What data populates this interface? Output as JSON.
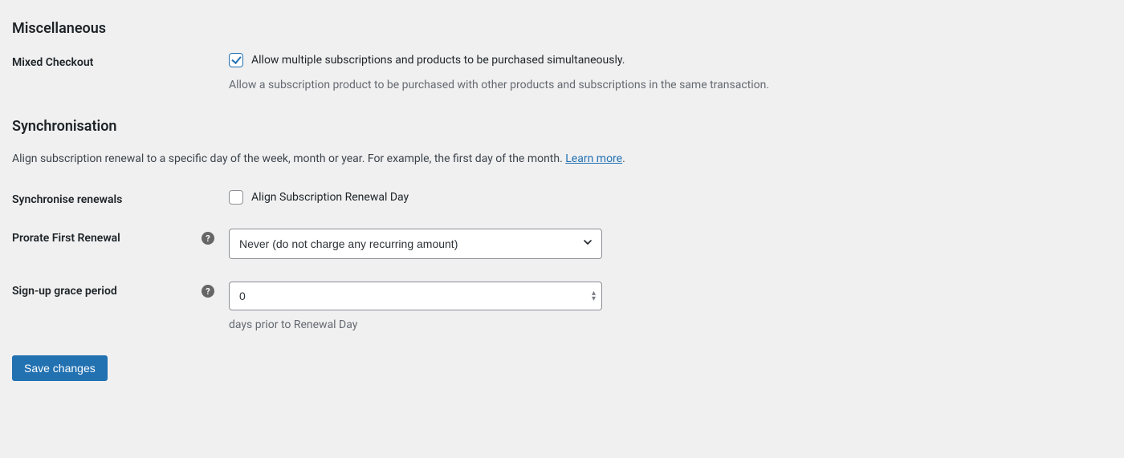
{
  "misc": {
    "heading": "Miscellaneous",
    "mixed_checkout": {
      "label": "Mixed Checkout",
      "checkbox_label": "Allow multiple subscriptions and products to be purchased simultaneously.",
      "description": "Allow a subscription product to be purchased with other products and subscriptions in the same transaction.",
      "checked": true
    }
  },
  "sync": {
    "heading": "Synchronisation",
    "description_prefix": "Align subscription renewal to a specific day of the week, month or year. For example, the first day of the month. ",
    "learn_more": "Learn more",
    "description_suffix": ".",
    "sync_renewals": {
      "label": "Synchronise renewals",
      "checkbox_label": "Align Subscription Renewal Day",
      "checked": false
    },
    "prorate": {
      "label": "Prorate First Renewal",
      "value": "Never (do not charge any recurring amount)"
    },
    "grace": {
      "label": "Sign-up grace period",
      "value": "0",
      "suffix": "days prior to Renewal Day"
    }
  },
  "save_button": "Save changes",
  "help_glyph": "?"
}
